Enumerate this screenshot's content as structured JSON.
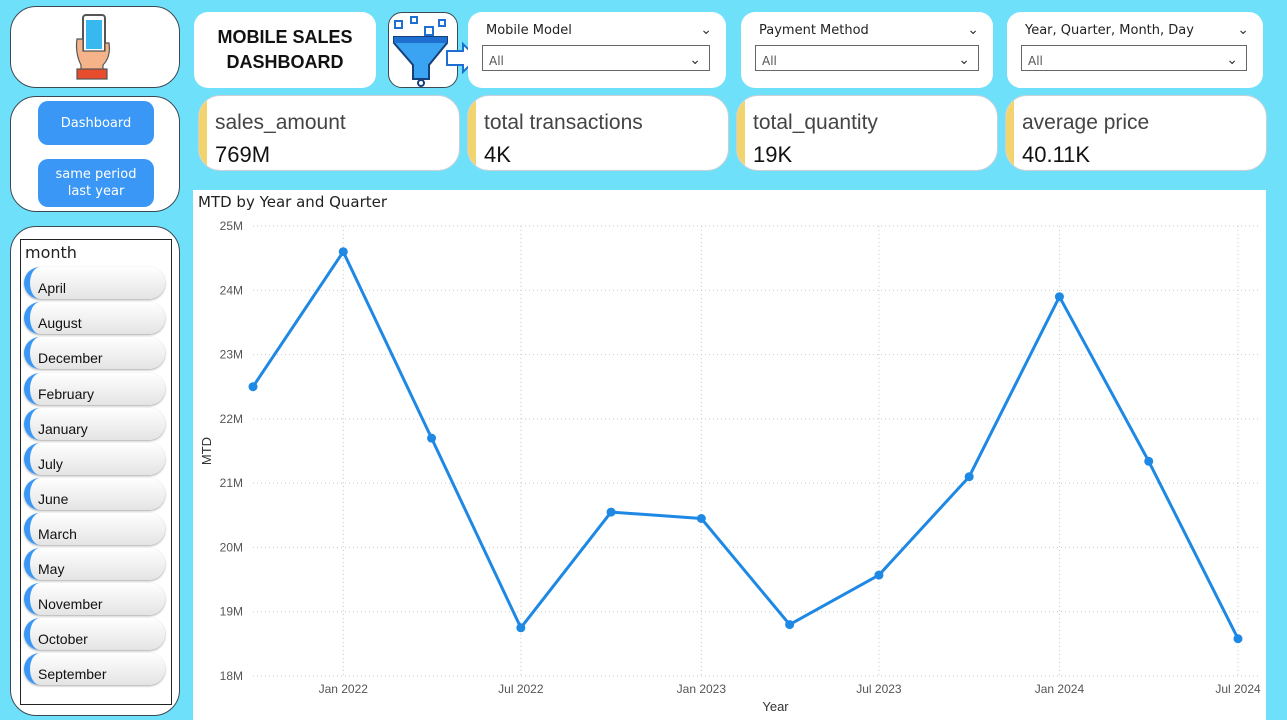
{
  "header": {
    "title": "MOBILE SALES\nDASHBOARD"
  },
  "icons": {
    "logo": "phone-in-hand-icon",
    "filter": "funnel-filter-icon"
  },
  "nav": {
    "items": [
      {
        "label": "Dashboard"
      },
      {
        "label": "same period last year"
      }
    ]
  },
  "filters": [
    {
      "label": "Mobile Model",
      "value": "All"
    },
    {
      "label": "Payment Method",
      "value": "All"
    },
    {
      "label": "Year, Quarter, Month, Day",
      "value": "All"
    }
  ],
  "kpis": [
    {
      "label": "sales_amount",
      "value": "769M"
    },
    {
      "label": "total transactions",
      "value": "4K"
    },
    {
      "label": "total_quantity",
      "value": "19K"
    },
    {
      "label": "average price",
      "value": "40.11K"
    }
  ],
  "month_slicer": {
    "title": "month",
    "items": [
      "April",
      "August",
      "December",
      "February",
      "January",
      "July",
      "June",
      "March",
      "May",
      "November",
      "October",
      "September"
    ]
  },
  "colors": {
    "background": "#6fe0f9",
    "accent": "#3a97f5",
    "kpi_bar": "#f2d46f",
    "line": "#1e88e5"
  },
  "chart_data": {
    "type": "line",
    "title": "MTD by Year and Quarter",
    "xlabel": "Year",
    "ylabel": "MTD",
    "x": [
      "2021-10-01",
      "2022-01-01",
      "2022-04-01",
      "2022-07-01",
      "2022-10-01",
      "2023-01-01",
      "2023-04-01",
      "2023-07-01",
      "2023-10-01",
      "2024-01-01",
      "2024-04-01",
      "2024-07-01"
    ],
    "x_ticks": [
      "Jan 2022",
      "Jul 2022",
      "Jan 2023",
      "Jul 2023",
      "Jan 2024",
      "Jul 2024"
    ],
    "y_ticks": [
      "18M",
      "19M",
      "20M",
      "21M",
      "22M",
      "23M",
      "24M",
      "25M"
    ],
    "ylim": [
      18000000,
      25000000
    ],
    "series": [
      {
        "values": [
          22500000,
          24600000,
          21700000,
          18750000,
          20550000,
          20450000,
          18800000,
          19570000,
          21100000,
          23900000,
          21340000,
          18580000
        ]
      }
    ],
    "grid": true
  }
}
